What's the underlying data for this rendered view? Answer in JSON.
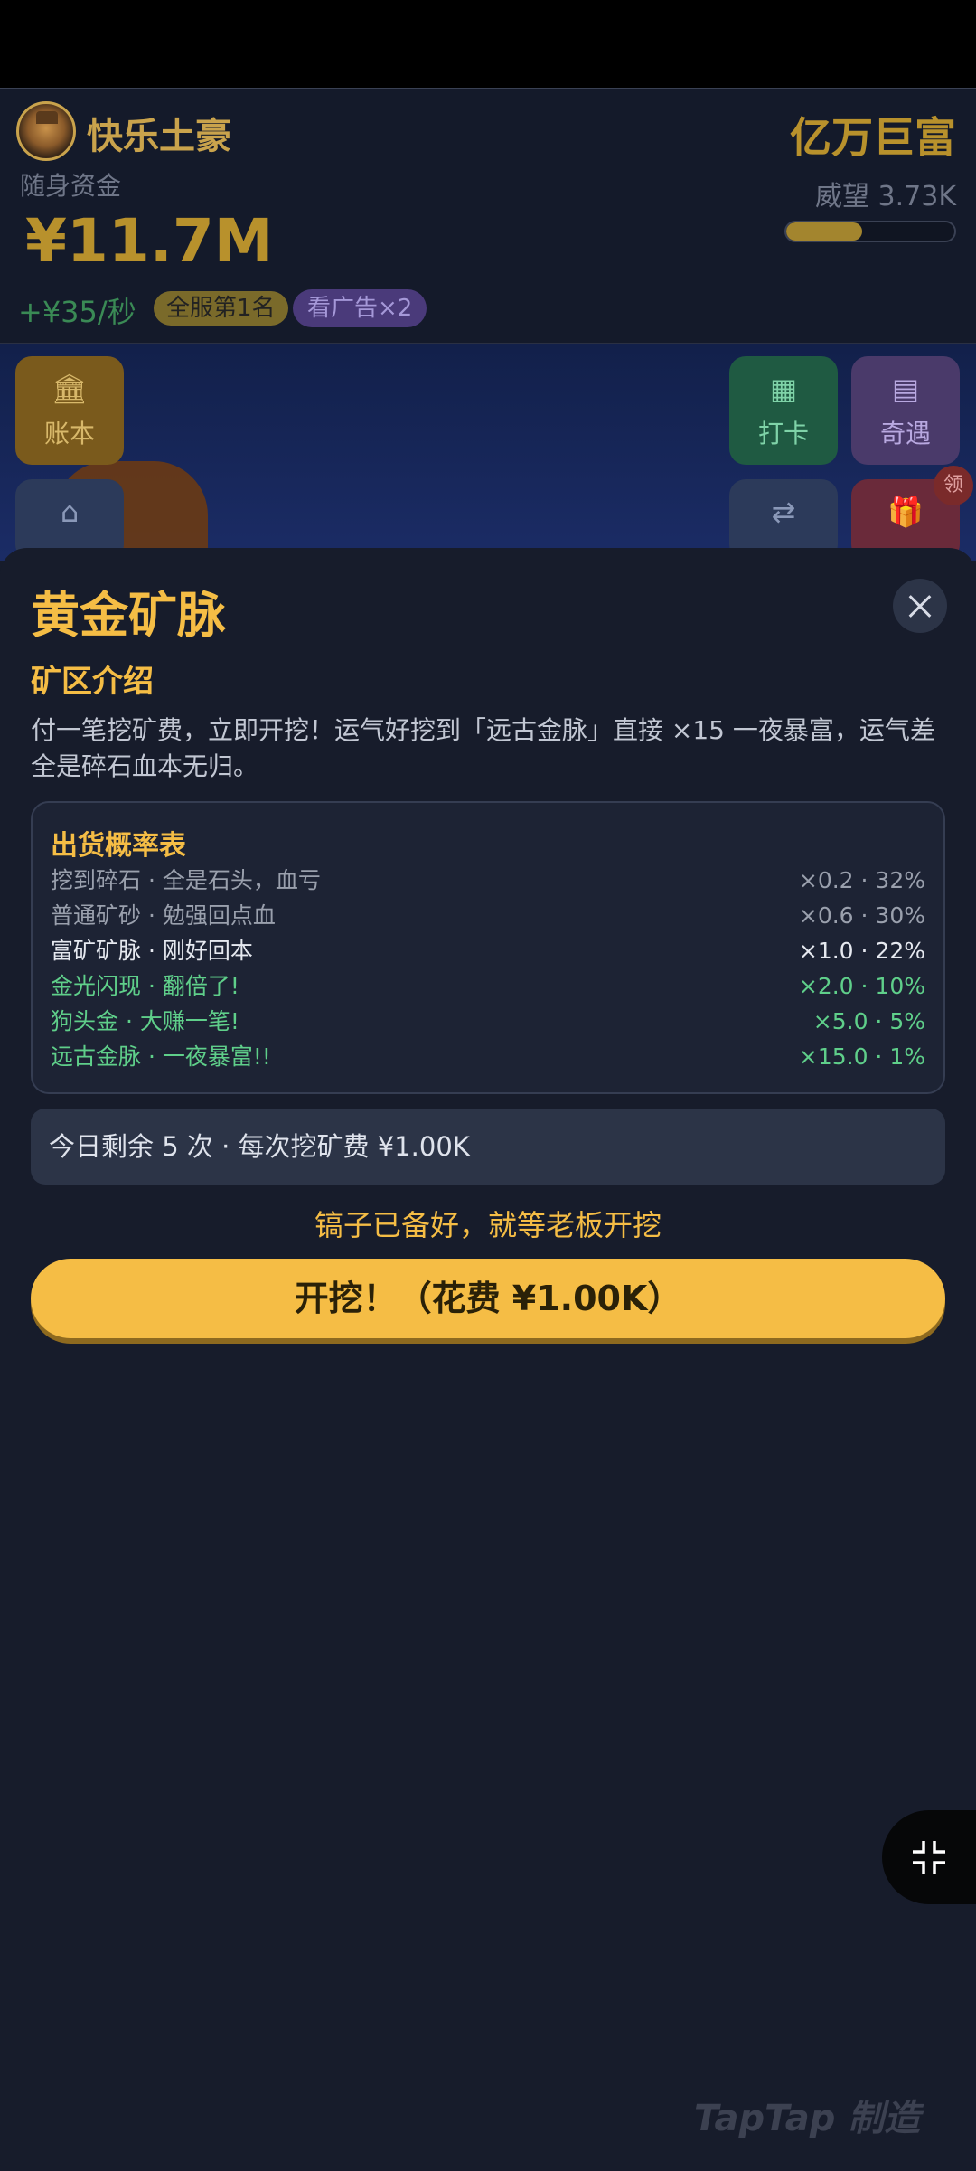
{
  "header": {
    "player_name": "快乐土豪",
    "rank_title": "亿万巨富",
    "funds_label": "随身资金",
    "funds": "¥11.7M",
    "prestige": "威望 3.73K",
    "prestige_progress": 0.45,
    "income": "+¥35/秒",
    "server_rank_badge": "全服第1名",
    "ad_badge": "看广告×2"
  },
  "tiles": {
    "ledger": "账本",
    "checkin": "打卡",
    "event": "奇遇",
    "claim_badge": "领"
  },
  "dialog": {
    "title": "黄金矿脉",
    "intro_heading": "矿区介绍",
    "intro_text": "付一笔挖矿费，立即开挖！运气好挖到「远古金脉」直接 ×15 一夜暴富，运气差全是碎石血本无归。",
    "table_title": "出货概率表",
    "table_rows": [
      {
        "label": "挖到碎石 · 全是石头，血亏",
        "value": "×0.2 · 32%",
        "color": "#9aa0ad"
      },
      {
        "label": "普通矿砂 · 勉强回点血",
        "value": "×0.6 · 30%",
        "color": "#9aa0ad"
      },
      {
        "label": "富矿矿脉 · 刚好回本",
        "value": "×1.0 · 22%",
        "color": "#e6e9f0"
      },
      {
        "label": "金光闪现 · 翻倍了!",
        "value": "×2.0 · 10%",
        "color": "#5fcf8a"
      },
      {
        "label": "狗头金 · 大赚一笔!",
        "value": "×5.0 · 5%",
        "color": "#5fcf8a"
      },
      {
        "label": "远古金脉 · 一夜暴富!!",
        "value": "×15.0 · 1%",
        "color": "#5fcf8a"
      }
    ],
    "remaining": "今日剩余 5 次 · 每次挖矿费 ¥1.00K",
    "hint": "镐子已备好，就等老板开挖",
    "dig_button": "开挖！（花费 ¥1.00K）"
  },
  "watermark": "TapTap 制造"
}
